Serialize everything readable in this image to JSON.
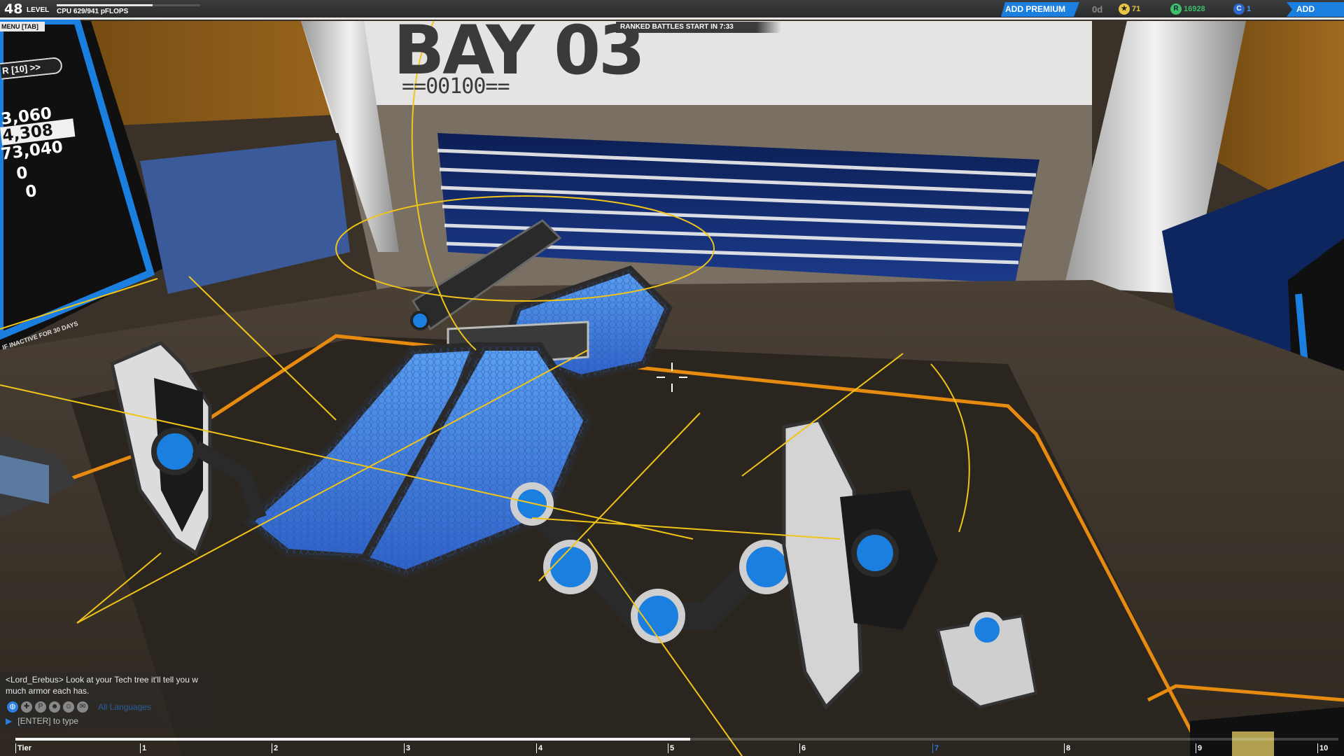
{
  "hud": {
    "level": "48",
    "level_label": "LEVEL",
    "cpu_text": "CPU 629/941 pFLOPS",
    "cpu_used": 629,
    "cpu_max": 941,
    "menu_label": "MENU [TAB]",
    "ranked_text": "RANKED BATTLES START IN 7:33",
    "add_premium_label": "ADD PREMIUM",
    "premium_days": "0d",
    "tech_points": "71",
    "robits": "16928",
    "cosmetic_credits": "1",
    "add_funds_label": "ADD FUNDS",
    "accent_blue": "#1b7fe0"
  },
  "bay": {
    "title": "BAY 03",
    "code": "==00100=="
  },
  "stats_panel": {
    "label": "R [10] >>",
    "values": [
      "3,060",
      "4,308",
      "73,040",
      "0",
      "0"
    ],
    "selected_index": 1,
    "note": "IF INACTIVE FOR 30 DAYS"
  },
  "chat": {
    "message": "<Lord_Erebus> Look at your Tech tree it'll tell you w much armor each has.",
    "channel_icons": [
      "globe-icon",
      "clan-icon",
      "party-icon",
      "group-icon",
      "friends-icon",
      "whisper-icon"
    ],
    "language_filter": "All Languages",
    "input_hint": "[ENTER] to type"
  },
  "tier_bar": {
    "label": "Tier",
    "ticks": [
      "1",
      "2",
      "3",
      "4",
      "5",
      "6",
      "7",
      "8",
      "9",
      "10"
    ],
    "progress_fraction": 0.51,
    "marker_index": 6
  }
}
